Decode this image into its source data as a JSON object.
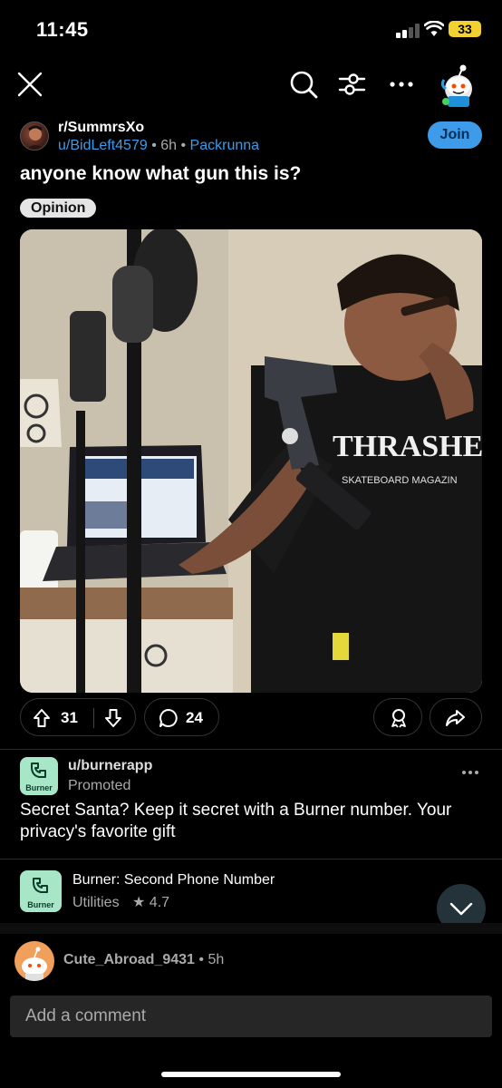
{
  "status_bar": {
    "time": "11:45",
    "battery": "33"
  },
  "post": {
    "subreddit": "r/SummrsXo",
    "author": "u/BidLeft4579",
    "age": "6h",
    "author_flair": "Packrunna",
    "join_label": "Join",
    "title": "anyone know what gun this is?",
    "flair": "Opinion",
    "upvotes": "31",
    "comments": "24",
    "image_shirt_text": "THRASHER",
    "image_shirt_subtext": "SKATEBOARD MAGAZIN"
  },
  "ad": {
    "user": "u/burnerapp",
    "promoted": "Promoted",
    "body": "Secret Santa? Keep it secret with a Burner number. Your privacy's favorite gift",
    "logo_label": "Burner",
    "app_name": "Burner: Second Phone Number",
    "app_category": "Utilities",
    "rating": "★ 4.7"
  },
  "comment": {
    "user": "Cute_Abroad_9431",
    "age": "5h"
  },
  "composer": {
    "placeholder": "Add a comment"
  },
  "colors": {
    "accent": "#3d9be9",
    "background": "#000000",
    "ad_logo": "#a8e6c8",
    "battery": "#f2d230"
  },
  "icons": [
    "close-icon",
    "search-icon",
    "filter-icon",
    "more-icon",
    "snoo-avatar-icon",
    "upvote-icon",
    "downvote-icon",
    "comment-icon",
    "award-icon",
    "share-icon",
    "chevron-down-icon",
    "phone-icon"
  ]
}
